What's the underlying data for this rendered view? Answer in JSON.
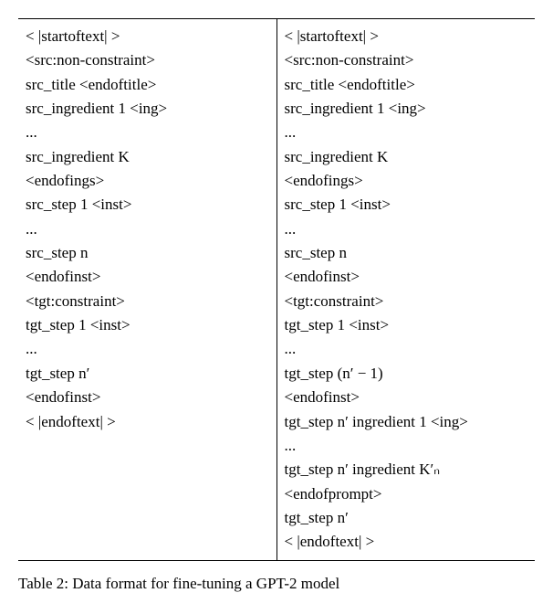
{
  "table": {
    "left": {
      "lines": [
        "< |startoftext| >",
        "<src:non-constraint>",
        "src_title <endoftitle>",
        "src_ingredient 1 <ing>",
        "...",
        "src_ingredient K",
        "<endofings>",
        "src_step 1 <inst>",
        "...",
        "src_step n",
        "<endofinst>",
        "<tgt:constraint>",
        "tgt_step 1 <inst>",
        "...",
        "tgt_step n′",
        "<endofinst>",
        "< |endoftext| >"
      ]
    },
    "right": {
      "lines": [
        "< |startoftext| >",
        "<src:non-constraint>",
        "src_title <endoftitle>",
        "src_ingredient 1 <ing>",
        "...",
        "src_ingredient K",
        "<endofings>",
        "src_step 1 <inst>",
        "...",
        "src_step n",
        "<endofinst>",
        "<tgt:constraint>",
        "tgt_step 1 <inst>",
        "...",
        "tgt_step (n′ − 1)",
        "<endofinst>",
        "tgt_step n′ ingredient 1 <ing>",
        "...",
        "tgt_step n′ ingredient K′ₙ",
        "<endofprompt>",
        "tgt_step n′",
        "< |endoftext| >"
      ]
    }
  },
  "caption": {
    "label": "Table 2: ",
    "text": "Data format for fine-tuning a GPT-2 model"
  }
}
